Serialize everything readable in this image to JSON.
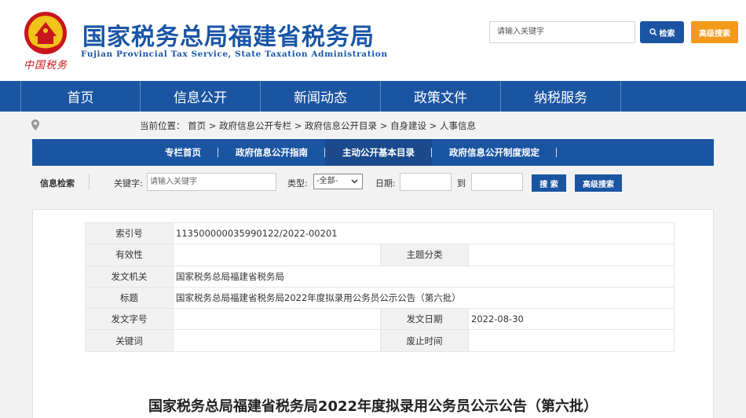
{
  "header": {
    "emblem_text": "中国税务",
    "title": "国家税务总局福建省税务局",
    "subtitle": "Fujian Provincial Tax Service, State Taxation Administration",
    "search_placeholder": "请输入关键字",
    "search_button": "检索",
    "advanced_button": "高级搜索",
    "colors": {
      "brand": "#1b55a2",
      "accent": "#f39a1a",
      "emblem_red": "#c8161d"
    }
  },
  "mainnav": {
    "items": [
      {
        "label": "首页"
      },
      {
        "label": "信息公开"
      },
      {
        "label": "新闻动态"
      },
      {
        "label": "政策文件"
      },
      {
        "label": "纳税服务"
      }
    ]
  },
  "breadcrumb": {
    "icon": "location-pin-icon",
    "text": "当前位置： 首页 > 政府信息公开专栏 > 政府信息公开目录 > 自身建设 > 人事信息"
  },
  "subnav": {
    "items": [
      {
        "label": "专栏首页"
      },
      {
        "label": "政府信息公开指南"
      },
      {
        "label": "主动公开基本目录",
        "active": true
      },
      {
        "label": "政府信息公开制度规定"
      }
    ]
  },
  "filter": {
    "section_label": "信息检索",
    "keyword_label": "关键字:",
    "keyword_placeholder": "请输入关键字",
    "type_label": "类型:",
    "type_value": "-全部-",
    "date_label": "日期:",
    "to_label": "到",
    "search_button": "搜 索",
    "advanced_button": "高级搜索"
  },
  "meta": {
    "rows": [
      {
        "k1": "索引号",
        "v1": "113500000035990122/2022-00201",
        "full": true
      },
      {
        "k1": "有效性",
        "v1": "",
        "k2": "主题分类",
        "v2": ""
      },
      {
        "k1": "发文机关",
        "v1": "国家税务总局福建省税务局",
        "full": true
      },
      {
        "k1": "标题",
        "v1": "国家税务总局福建省税务局2022年度拟录用公务员公示公告（第六批）",
        "full": true
      },
      {
        "k1": "发文字号",
        "v1": "",
        "k2": "发文日期",
        "v2": "2022-08-30"
      },
      {
        "k1": "关键词",
        "v1": "",
        "k2": "废止时间",
        "v2": ""
      }
    ]
  },
  "article": {
    "title": "国家税务总局福建省税务局2022年度拟录用公务员公示公告（第六批）"
  }
}
